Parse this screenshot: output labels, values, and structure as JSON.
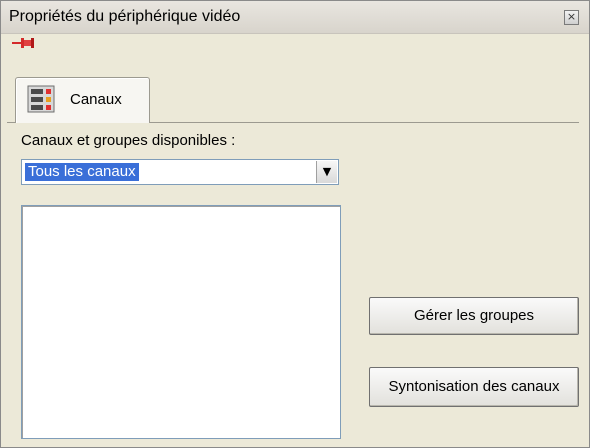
{
  "window": {
    "title": "Propriétés du périphérique vidéo",
    "close_icon": "close-icon"
  },
  "toolbar": {
    "pin_icon": "pin-icon"
  },
  "tabs": [
    {
      "label": "Canaux",
      "icon": "channels-icon",
      "selected": true
    }
  ],
  "channels": {
    "available_label": "Canaux et groupes disponibles :",
    "group_select": {
      "selected_value": "Tous les canaux"
    },
    "list_items": []
  },
  "buttons": {
    "manage_groups": "Gérer les groupes",
    "channel_tuning": "Syntonisation des canaux"
  },
  "colors": {
    "selection": "#3a6fd8",
    "pin_red": "#d42a2a"
  }
}
